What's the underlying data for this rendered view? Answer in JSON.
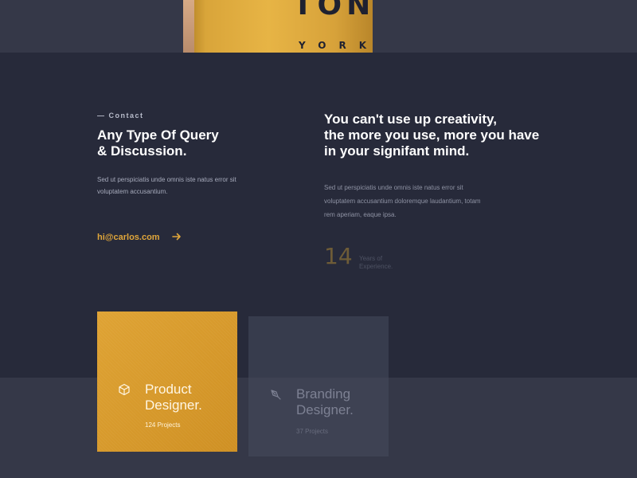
{
  "hero": {
    "shirt_text_top": "TON",
    "shirt_text_bottom": "YORK"
  },
  "contact": {
    "label": "— Contact",
    "heading_line1": "Any Type Of Query",
    "heading_line2": "& Discussion.",
    "body": "Sed ut perspiciatis unde omnis iste natus error sit voluptatem accusantium.",
    "email": "hi@carlos.com",
    "arrow_icon": "arrow-right-icon"
  },
  "about": {
    "quote_line1": "You can't use up creativity,",
    "quote_line2": "the more you use, more you have",
    "quote_line3": "in your signifant mind.",
    "body": "Sed ut perspiciatis unde omnis iste natus error sit voluptatem accusantium doloremque laudantium, totam rem aperiam, eaque ipsa.",
    "experience_number": "14",
    "experience_label": "Years of Experience."
  },
  "cards": [
    {
      "title_line1": "Product",
      "title_line2": "Designer.",
      "projects": "124 Projects",
      "icon": "cube-icon"
    },
    {
      "title_line1": "Branding",
      "title_line2": "Designer.",
      "projects": "37 Projects",
      "icon": "pen-tool-icon"
    }
  ],
  "colors": {
    "accent": "#e0a63a",
    "background": "#272a3a",
    "band": "#353848"
  }
}
